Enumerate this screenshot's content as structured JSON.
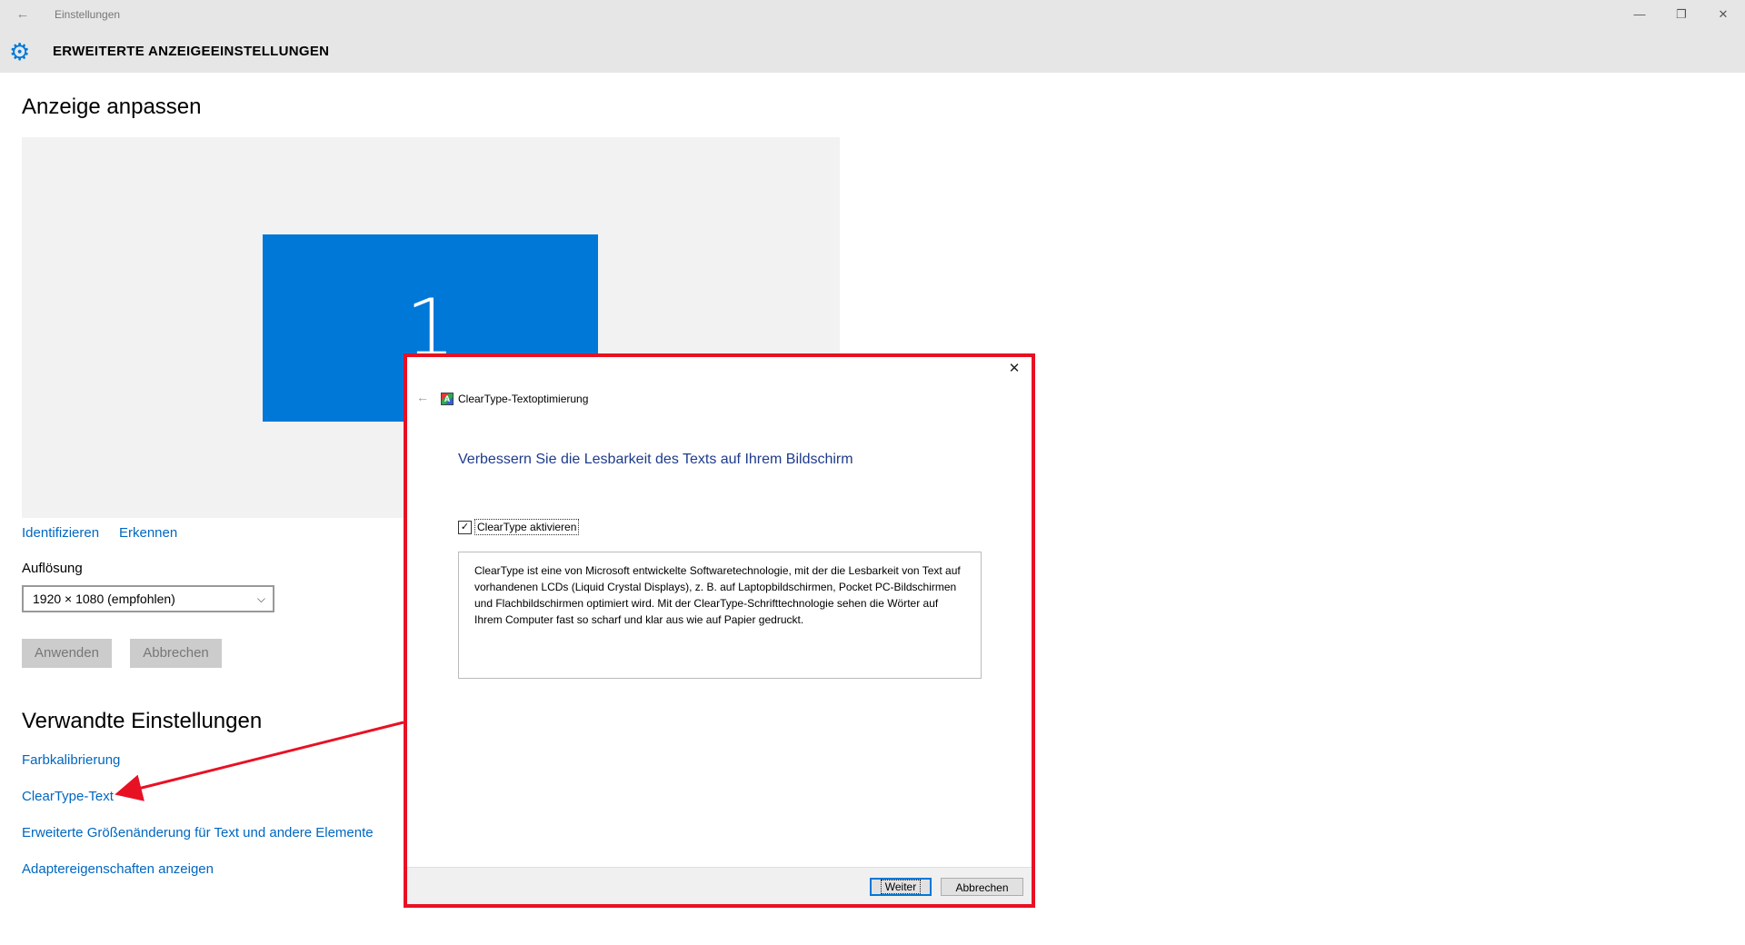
{
  "window": {
    "back_icon": "back-arrow-icon",
    "title": "Einstellungen",
    "controls": {
      "minimize": "—",
      "restore": "❐",
      "close": "✕"
    }
  },
  "header": {
    "gear_icon": "gear-icon",
    "section_title": "ERWEITERTE ANZEIGEEINSTELLUNGEN"
  },
  "main": {
    "heading": "Anzeige anpassen",
    "monitor_number": "1",
    "links": {
      "identify": "Identifizieren",
      "detect": "Erkennen"
    },
    "resolution_label": "Auflösung",
    "resolution_value": "1920 × 1080 (empfohlen)",
    "apply_label": "Anwenden",
    "cancel_label": "Abbrechen",
    "related_heading": "Verwandte Einstellungen",
    "related_links": [
      "Farbkalibrierung",
      "ClearType-Text",
      "Erweiterte Größenänderung für Text und andere Elemente",
      "Adaptereigenschaften anzeigen"
    ]
  },
  "dialog": {
    "close": "✕",
    "back": "←",
    "icon_letter": "A",
    "title": "ClearType-Textoptimierung",
    "heading": "Verbessern Sie die Lesbarkeit des Texts auf Ihrem Bildschirm",
    "checkbox_checked": true,
    "checkbox_label": "ClearType aktivieren",
    "description": "ClearType ist eine von Microsoft entwickelte Softwaretechnologie, mit der die Lesbarkeit von Text auf vorhandenen LCDs (Liquid Crystal Displays), z. B. auf Laptopbildschirmen, Pocket PC-Bildschirmen und Flachbildschirmen optimiert wird. Mit der ClearType-Schrifttechnologie sehen die Wörter auf Ihrem Computer fast so scharf und klar aus wie auf Papier gedruckt.",
    "next_label": "Weiter",
    "cancel_label": "Abbrechen"
  },
  "colors": {
    "accent": "#0078d7",
    "link": "#0067c0",
    "highlight_border": "#e81123"
  }
}
